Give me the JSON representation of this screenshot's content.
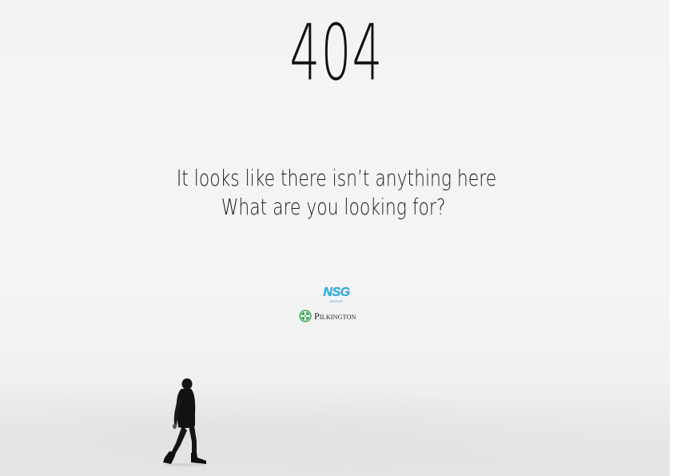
{
  "error": {
    "code": "404",
    "line1": "It looks like there isn’t anything here",
    "line2": "What are you looking for?"
  },
  "logos": {
    "nsg": "NSG",
    "nsg_sub": "GROUP",
    "pilkington": "Pilkington",
    "nsg_color": "#33b5e5",
    "pilkington_icon_color": "#2e9e4a"
  },
  "background": {
    "color": "#f4f4f4",
    "image": "person-walking-on-snow"
  }
}
